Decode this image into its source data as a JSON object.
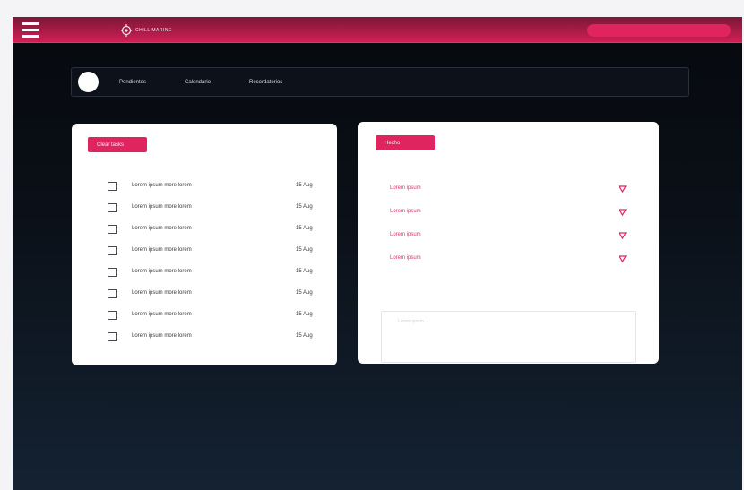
{
  "header": {
    "logo_text": "CHILL MARINE",
    "logo_icon": "gear-icon"
  },
  "nav": {
    "items": [
      {
        "label": "Pendientes"
      },
      {
        "label": "Calendario"
      },
      {
        "label": "Recordatorios"
      }
    ]
  },
  "tasks": {
    "button_label": "Clear tasks",
    "items": [
      {
        "text": "Lorem ipsum more lorem",
        "date": "15 Aug"
      },
      {
        "text": "Lorem ipsum more lorem",
        "date": "15 Aug"
      },
      {
        "text": "Lorem ipsum more lorem",
        "date": "15 Aug"
      },
      {
        "text": "Lorem ipsum more lorem",
        "date": "15 Aug"
      },
      {
        "text": "Lorem ipsum more lorem",
        "date": "15 Aug"
      },
      {
        "text": "Lorem ipsum more lorem",
        "date": "15 Aug"
      },
      {
        "text": "Lorem ipsum more lorem",
        "date": "15 Aug"
      },
      {
        "text": "Lorem ipsum more lorem",
        "date": "15 Aug"
      }
    ]
  },
  "notes": {
    "button_label": "Hecho",
    "dropdowns": [
      {
        "label": "Lorem ipsum"
      },
      {
        "label": "Lorem ipsum"
      },
      {
        "label": "Lorem ipsum"
      },
      {
        "label": "Lorem ipsum"
      }
    ],
    "textarea_placeholder": "Lorem ipsum ..."
  },
  "colors": {
    "accent": "#e0245e",
    "background_dark": "#0b1119"
  }
}
